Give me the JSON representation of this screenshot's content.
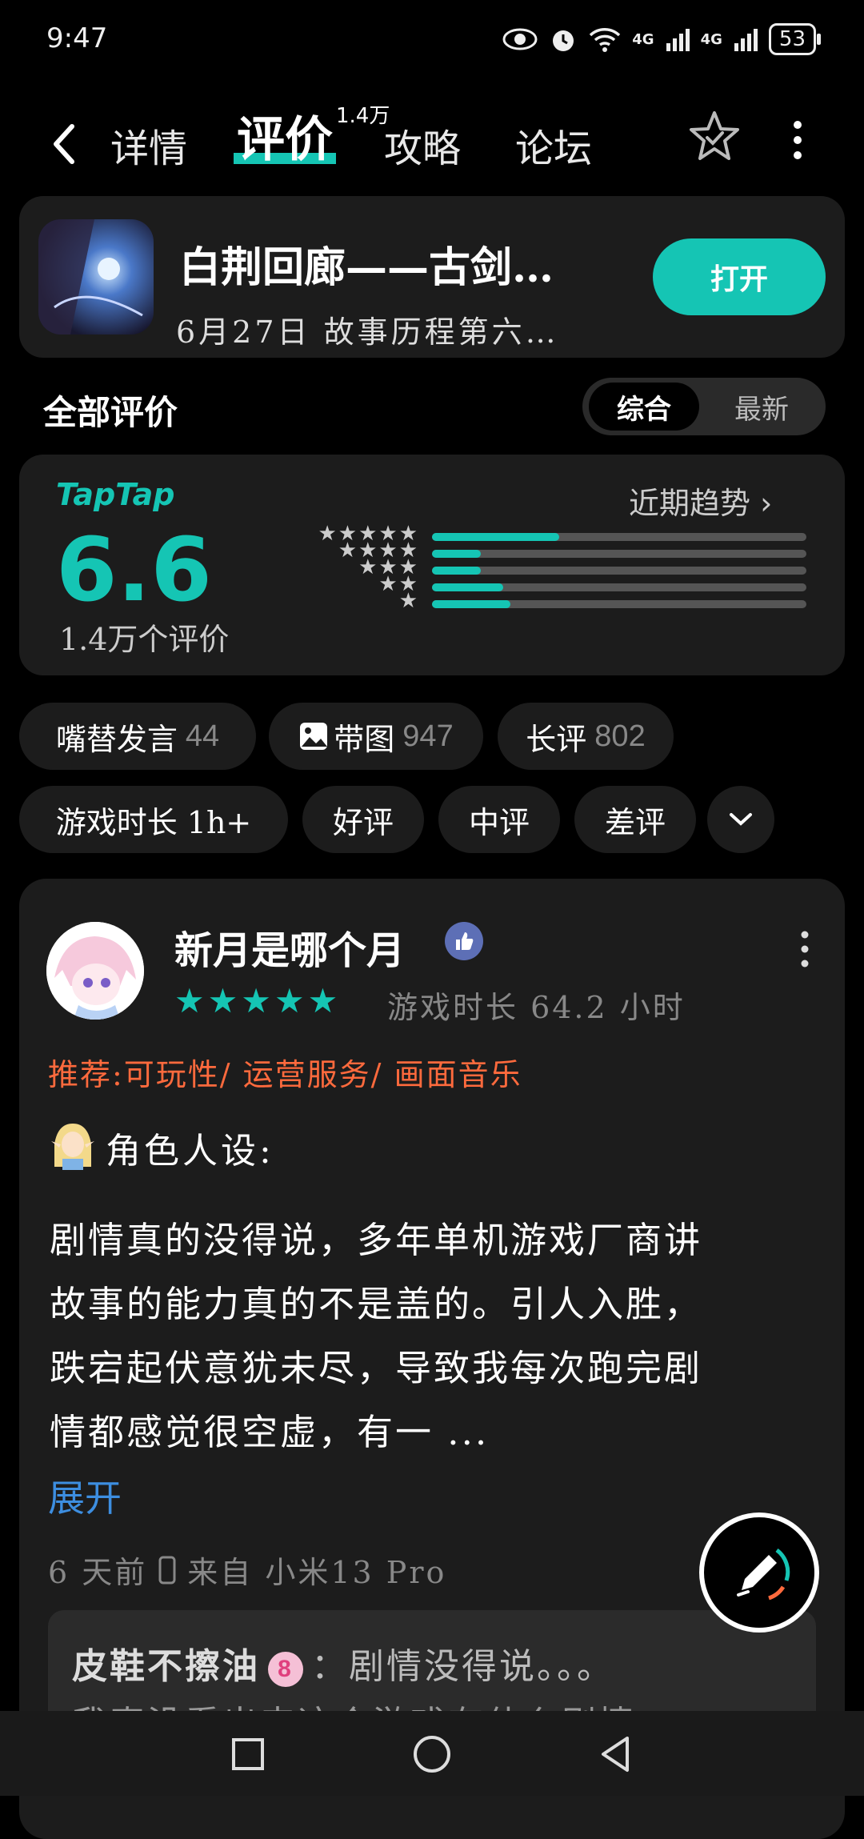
{
  "status": {
    "time": "9:47",
    "net1": "4G",
    "net2": "4G",
    "battery": "53"
  },
  "nav": {
    "tabs": [
      "详情",
      "评价",
      "攻略",
      "论坛"
    ],
    "active": "评价",
    "review_count_badge": "1.4万"
  },
  "game": {
    "title": "白荆回廊——古剑…",
    "subtitle": "6月27日 故事历程第六…",
    "open_label": "打开"
  },
  "reviews_header": {
    "title": "全部评价",
    "sort_options": [
      "综合",
      "最新"
    ],
    "selected_sort": "综合"
  },
  "rating": {
    "brand": "TapTap",
    "score": "6.6",
    "count_label": "1.4万个评价",
    "trend_label": "近期趋势",
    "distribution": [
      {
        "stars": 5,
        "fraction": 0.34
      },
      {
        "stars": 4,
        "fraction": 0.13
      },
      {
        "stars": 3,
        "fraction": 0.13
      },
      {
        "stars": 2,
        "fraction": 0.19
      },
      {
        "stars": 1,
        "fraction": 0.21
      }
    ]
  },
  "filters": {
    "row1": [
      {
        "label": "嘴替发言",
        "count": "44"
      },
      {
        "label": "带图",
        "count": "947",
        "icon": "image-icon"
      },
      {
        "label": "长评",
        "count": "802"
      }
    ],
    "row2": [
      {
        "label": "游戏时长 1h+"
      },
      {
        "label": "好评"
      },
      {
        "label": "中评"
      },
      {
        "label": "差评"
      }
    ]
  },
  "review": {
    "author": "新月是哪个月",
    "stars": "★★★★★",
    "playtime": "游戏时长 64.2 小时",
    "recommend": "推荐:可玩性/ 运营服务/ 画面音乐",
    "section_label": "角色人设:",
    "body_lines": [
      "剧情真的没得说，多年单机游戏厂商讲",
      "故事的能力真的不是盖的。引人入胜，",
      "跌宕起伏意犹未尽，导致我每次跑完剧",
      "情都感觉很空虚，有一 ..."
    ],
    "expand_label": "展开",
    "time": "6 天前",
    "device": "来自 小米13 Pro",
    "reply": {
      "author": "皮鞋不擦油",
      "level": "8",
      "text": "：剧情没得说。。。",
      "line2": "我真没看出来这个游戏有什么剧情"
    }
  },
  "colors": {
    "accent": "#15c5b4",
    "recommend": "#ff6a3d",
    "link": "#3d8ee0"
  }
}
